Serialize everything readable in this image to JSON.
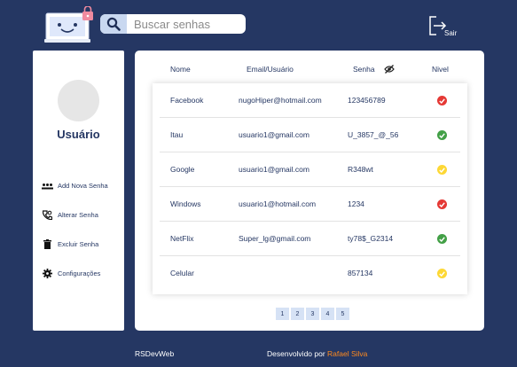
{
  "header": {
    "search_placeholder": "Buscar senhas",
    "exit_label": "Sair"
  },
  "sidebar": {
    "username": "Usuário",
    "items": [
      {
        "label": "Add Nova Senha",
        "icon": "add-icon"
      },
      {
        "label": "Alterar Senha",
        "icon": "edit-key-icon"
      },
      {
        "label": "Excluir Senha",
        "icon": "trash-icon"
      },
      {
        "label": "Configurações",
        "icon": "gear-icon"
      }
    ]
  },
  "table": {
    "headers": {
      "name": "Nome",
      "email": "Email/Usuário",
      "password": "Senha",
      "level": "Nivel"
    },
    "rows": [
      {
        "name": "Facebook",
        "email": "nugoHiper@hotmail.com",
        "password": "123456789",
        "level": "weak"
      },
      {
        "name": "Itau",
        "email": "usuario1@gmail.com",
        "password": "U_3857_@_56",
        "level": "strong"
      },
      {
        "name": "Google",
        "email": "usuario1@gmail.com",
        "password": "R348wt",
        "level": "medium"
      },
      {
        "name": "Windows",
        "email": "usuario1@hotmail.com",
        "password": "1234",
        "level": "weak"
      },
      {
        "name": "NetFlix",
        "email": "Super_lg@gmail.com",
        "password": "ty78$_G2314",
        "level": "strong"
      },
      {
        "name": "Celular",
        "email": "",
        "password": "857134",
        "level": "medium"
      }
    ],
    "level_colors": {
      "weak": "#e53935",
      "strong": "#43a047",
      "medium": "#fdd835"
    }
  },
  "pagination": [
    "1",
    "2",
    "3",
    "4",
    "5"
  ],
  "footer": {
    "brand": "RSDevWeb",
    "credit": "Desenvolvido por ",
    "author": "Rafael Silva"
  },
  "colors": {
    "background": "#253763",
    "accent": "#ff8a1e",
    "search_icon_bg": "#c9d8f0"
  }
}
